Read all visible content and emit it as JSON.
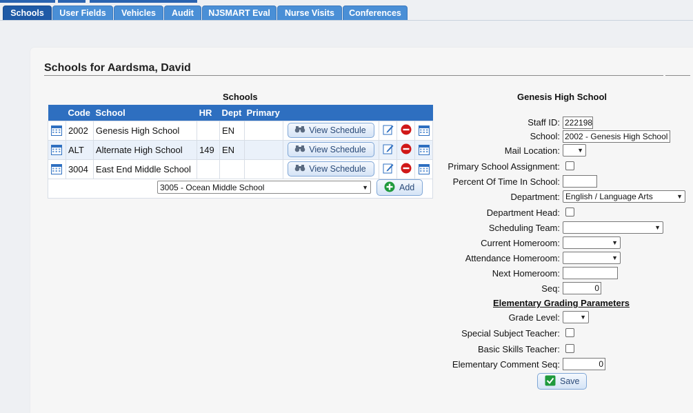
{
  "tabs": [
    {
      "label": "Schools",
      "active": true
    },
    {
      "label": "User Fields"
    },
    {
      "label": "Vehicles"
    },
    {
      "label": "Audit"
    },
    {
      "label": "NJSMART Eval"
    },
    {
      "label": "Nurse Visits"
    },
    {
      "label": "Conferences"
    }
  ],
  "page_title": "Schools for Aardsma, David",
  "schools_section": {
    "title": "Schools",
    "columns": [
      "Code",
      "School",
      "HR",
      "Dept",
      "Primary"
    ],
    "rows": [
      {
        "code": "2002",
        "school": "Genesis High School",
        "hr": "",
        "dept": "EN",
        "primary": "",
        "view_label": "View Schedule"
      },
      {
        "code": "ALT",
        "school": "Alternate High School",
        "hr": "149",
        "dept": "EN",
        "primary": "",
        "view_label": "View Schedule"
      },
      {
        "code": "3004",
        "school": "East End Middle School",
        "hr": "",
        "dept": "",
        "primary": "",
        "view_label": "View Schedule"
      }
    ],
    "add_select_value": "3005 - Ocean Middle School",
    "add_label": "Add"
  },
  "detail": {
    "title": "Genesis High School",
    "staff_id_label": "Staff ID:",
    "staff_id": "222198",
    "school_label": "School:",
    "school": "2002 - Genesis High School",
    "mail_location_label": "Mail Location:",
    "primary_assignment_label": "Primary School Assignment:",
    "percent_time_label": "Percent Of Time In School:",
    "department_label": "Department:",
    "department": "English / Language Arts",
    "dept_head_label": "Department Head:",
    "scheduling_team_label": "Scheduling Team:",
    "current_homeroom_label": "Current Homeroom:",
    "attendance_homeroom_label": "Attendance Homeroom:",
    "next_homeroom_label": "Next Homeroom:",
    "seq_label": "Seq:",
    "seq": "0",
    "elementary_heading": "Elementary Grading Parameters",
    "grade_level_label": "Grade Level:",
    "special_subject_label": "Special Subject Teacher:",
    "basic_skills_label": "Basic Skills Teacher:",
    "elem_comment_seq_label": "Elementary Comment Seq:",
    "elem_comment_seq": "0",
    "save_label": "Save"
  }
}
